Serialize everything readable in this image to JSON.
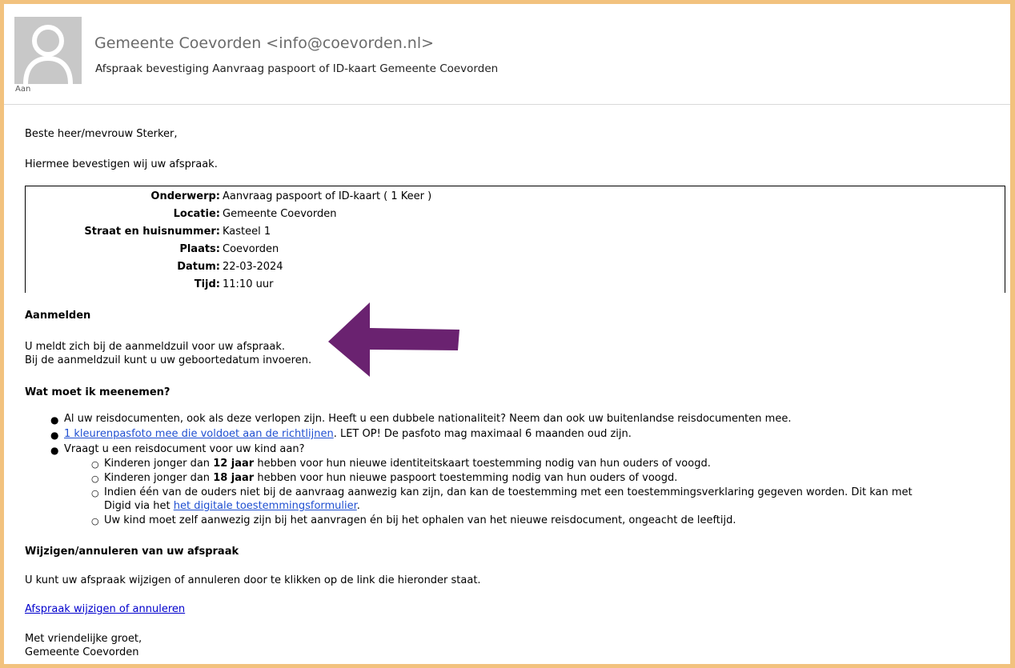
{
  "email": {
    "sender": "Gemeente Coevorden <info@coevorden.nl>",
    "subject": "Afspraak bevestiging Aanvraag paspoort of ID-kaart Gemeente Coevorden",
    "to_label": "Aan"
  },
  "body": {
    "greeting": "Beste heer/mevrouw Sterker,",
    "intro": "Hiermee bevestigen wij uw afspraak.",
    "details": [
      {
        "label": "Onderwerp:",
        "value": "Aanvraag paspoort of ID-kaart ( 1 Keer )"
      },
      {
        "label": "Locatie:",
        "value": "Gemeente Coevorden"
      },
      {
        "label": "Straat en huisnummer:",
        "value": "Kasteel 1"
      },
      {
        "label": "Plaats:",
        "value": "Coevorden"
      },
      {
        "label": "Datum:",
        "value": "22-03-2024"
      },
      {
        "label": "Tijd:",
        "value": "11:10 uur"
      }
    ],
    "aanmelden_heading": "Aanmelden",
    "aanmelden_line1": "U meldt zich bij de aanmeldzuil voor uw afspraak.",
    "aanmelden_line2": "Bij de aanmeldzuil kunt u uw geboortedatum invoeren.",
    "meenemen_heading": "Wat moet ik meenemen?",
    "bullet1": "Al uw reisdocumenten, ook als deze verlopen zijn. Heeft u een dubbele nationaliteit? Neem dan ook uw buitenlandse reisdocumenten mee.",
    "bullet2_link": "1 kleurenpasfoto mee die voldoet aan de richtlijnen",
    "bullet2_rest": ". LET OP! De pasfoto mag maximaal 6 maanden oud zijn.",
    "bullet3": "Vraagt u een reisdocument voor uw kind aan?",
    "sub1_pre": "Kinderen jonger dan ",
    "sub1_bold": "12 jaar",
    "sub1_post": " hebben voor hun nieuwe identiteitskaart toestemming nodig van hun ouders of voogd.",
    "sub2_pre": "Kinderen jonger dan ",
    "sub2_bold": "18 jaar",
    "sub2_post": " hebben voor hun nieuwe paspoort toestemming nodig van hun ouders of voogd.",
    "sub3_line1": "Indien één van de ouders niet bij de aanvraag aanwezig kan zijn, dan kan de toestemming met een toestemmingsverklaring gegeven worden. Dit kan met",
    "sub3_line2_pre": "Digid via het ",
    "sub3_link": "het digitale toestemmingsformulier",
    "sub3_line2_post": ".",
    "sub4": "Uw kind moet zelf aanwezig zijn bij het aanvragen én bij het ophalen van het nieuwe reisdocument, ongeacht de leeftijd.",
    "wijzigen_heading": "Wijzigen/annuleren van uw afspraak",
    "wijzigen_text": "U kunt uw afspraak wijzigen of annuleren door te klikken op de link die hieronder staat.",
    "wijzigen_link": "Afspraak wijzigen of annuleren",
    "closing1": "Met vriendelijke groet,",
    "closing2": "Gemeente Coevorden"
  },
  "colors": {
    "frame": "#f2c27e",
    "arrow": "#6a2270",
    "link": "#1f4fd1"
  }
}
